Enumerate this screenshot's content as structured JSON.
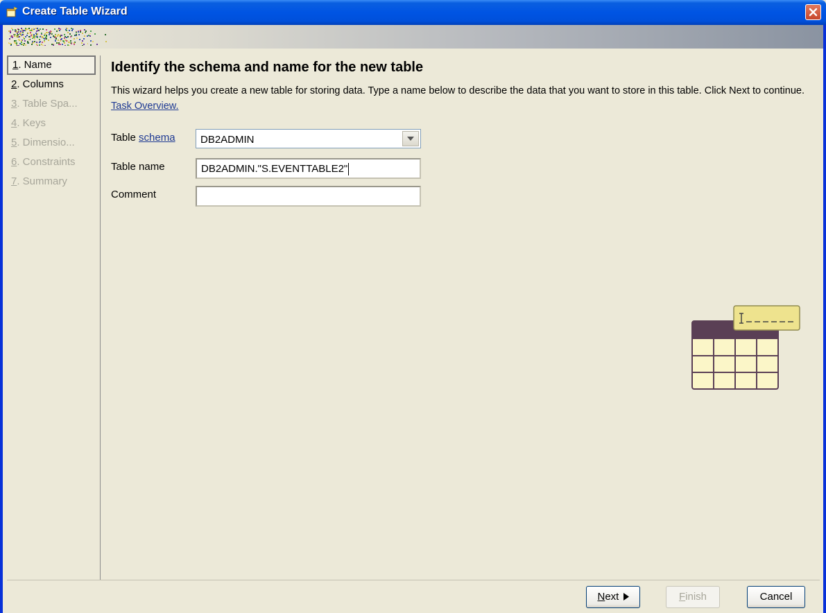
{
  "window": {
    "title": "Create Table Wizard",
    "close_icon": "close-icon"
  },
  "steps": [
    {
      "num": "1",
      "label": ". Name",
      "state": "active"
    },
    {
      "num": "2",
      "label": ". Columns",
      "state": "enabled"
    },
    {
      "num": "3",
      "label": ". Table Spa...",
      "state": "disabled"
    },
    {
      "num": "4",
      "label": ". Keys",
      "state": "disabled"
    },
    {
      "num": "5",
      "label": ". Dimensio...",
      "state": "disabled"
    },
    {
      "num": "6",
      "label": ". Constraints",
      "state": "disabled"
    },
    {
      "num": "7",
      "label": ". Summary",
      "state": "disabled"
    }
  ],
  "main": {
    "heading": "Identify the schema and name for the new table",
    "description": "This wizard helps you create a new table for storing data. Type a name below to describe the data that you want to store in this table. Click Next to continue. ",
    "task_link": "Task Overview."
  },
  "form": {
    "schema_label_prefix": "Table ",
    "schema_label_link": "schema",
    "schema_value": "DB2ADMIN",
    "name_label": "Table name",
    "name_value": "DB2ADMIN.\"S.EVENTTABLE2\"",
    "comment_label": "Comment",
    "comment_value": ""
  },
  "buttons": {
    "next_mnemonic": "N",
    "next_rest": "ext",
    "finish_mnemonic": "F",
    "finish_rest": "inish",
    "cancel": "Cancel"
  },
  "colors": {
    "title_bar": "#0054E3",
    "window_bg": "#ECE9D8",
    "link": "#1F3A93",
    "table_header": "#5A3F55",
    "table_cell": "#FBF6C8"
  }
}
